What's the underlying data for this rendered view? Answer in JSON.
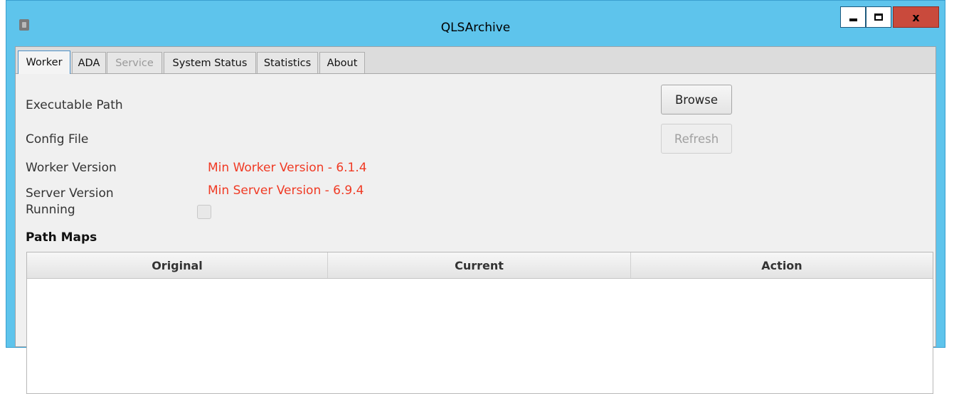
{
  "window": {
    "title": "QLSArchive"
  },
  "controls": {
    "close": "x"
  },
  "tabs": [
    {
      "label": "Worker"
    },
    {
      "label": "ADA"
    },
    {
      "label": "Service"
    },
    {
      "label": "System Status"
    },
    {
      "label": "Statistics"
    },
    {
      "label": "About"
    }
  ],
  "worker": {
    "executable_path_label": "Executable Path",
    "config_file_label": "Config File",
    "worker_version_label": "Worker Version",
    "min_worker_version": "Min Worker Version - 6.1.4",
    "server_version_label": "Server Version",
    "min_server_version": "Min Server Version - 6.9.4",
    "running_label": "Running",
    "running_checked": false,
    "browse_label": "Browse",
    "refresh_label": "Refresh",
    "path_maps_label": "Path Maps",
    "table_headers": [
      "Original",
      "Current",
      "Action"
    ]
  },
  "colors": {
    "titlebar": "#5ec4ec",
    "warning_text": "#f03a24",
    "close_button": "#c94a3c"
  }
}
